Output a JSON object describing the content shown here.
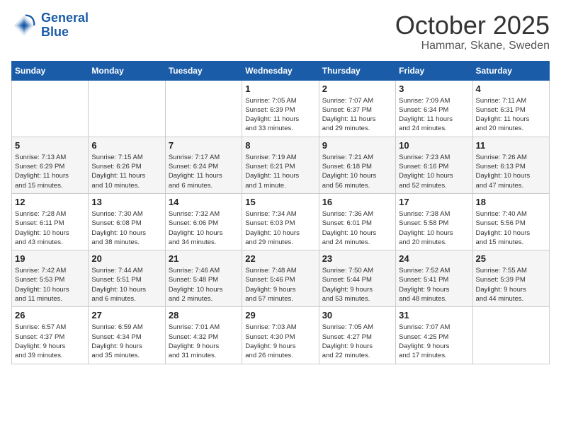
{
  "header": {
    "logo_line1": "General",
    "logo_line2": "Blue",
    "month": "October 2025",
    "location": "Hammar, Skane, Sweden"
  },
  "days_of_week": [
    "Sunday",
    "Monday",
    "Tuesday",
    "Wednesday",
    "Thursday",
    "Friday",
    "Saturday"
  ],
  "weeks": [
    [
      {
        "day": "",
        "info": ""
      },
      {
        "day": "",
        "info": ""
      },
      {
        "day": "",
        "info": ""
      },
      {
        "day": "1",
        "info": "Sunrise: 7:05 AM\nSunset: 6:39 PM\nDaylight: 11 hours\nand 33 minutes."
      },
      {
        "day": "2",
        "info": "Sunrise: 7:07 AM\nSunset: 6:37 PM\nDaylight: 11 hours\nand 29 minutes."
      },
      {
        "day": "3",
        "info": "Sunrise: 7:09 AM\nSunset: 6:34 PM\nDaylight: 11 hours\nand 24 minutes."
      },
      {
        "day": "4",
        "info": "Sunrise: 7:11 AM\nSunset: 6:31 PM\nDaylight: 11 hours\nand 20 minutes."
      }
    ],
    [
      {
        "day": "5",
        "info": "Sunrise: 7:13 AM\nSunset: 6:29 PM\nDaylight: 11 hours\nand 15 minutes."
      },
      {
        "day": "6",
        "info": "Sunrise: 7:15 AM\nSunset: 6:26 PM\nDaylight: 11 hours\nand 10 minutes."
      },
      {
        "day": "7",
        "info": "Sunrise: 7:17 AM\nSunset: 6:24 PM\nDaylight: 11 hours\nand 6 minutes."
      },
      {
        "day": "8",
        "info": "Sunrise: 7:19 AM\nSunset: 6:21 PM\nDaylight: 11 hours\nand 1 minute."
      },
      {
        "day": "9",
        "info": "Sunrise: 7:21 AM\nSunset: 6:18 PM\nDaylight: 10 hours\nand 56 minutes."
      },
      {
        "day": "10",
        "info": "Sunrise: 7:23 AM\nSunset: 6:16 PM\nDaylight: 10 hours\nand 52 minutes."
      },
      {
        "day": "11",
        "info": "Sunrise: 7:26 AM\nSunset: 6:13 PM\nDaylight: 10 hours\nand 47 minutes."
      }
    ],
    [
      {
        "day": "12",
        "info": "Sunrise: 7:28 AM\nSunset: 6:11 PM\nDaylight: 10 hours\nand 43 minutes."
      },
      {
        "day": "13",
        "info": "Sunrise: 7:30 AM\nSunset: 6:08 PM\nDaylight: 10 hours\nand 38 minutes."
      },
      {
        "day": "14",
        "info": "Sunrise: 7:32 AM\nSunset: 6:06 PM\nDaylight: 10 hours\nand 34 minutes."
      },
      {
        "day": "15",
        "info": "Sunrise: 7:34 AM\nSunset: 6:03 PM\nDaylight: 10 hours\nand 29 minutes."
      },
      {
        "day": "16",
        "info": "Sunrise: 7:36 AM\nSunset: 6:01 PM\nDaylight: 10 hours\nand 24 minutes."
      },
      {
        "day": "17",
        "info": "Sunrise: 7:38 AM\nSunset: 5:58 PM\nDaylight: 10 hours\nand 20 minutes."
      },
      {
        "day": "18",
        "info": "Sunrise: 7:40 AM\nSunset: 5:56 PM\nDaylight: 10 hours\nand 15 minutes."
      }
    ],
    [
      {
        "day": "19",
        "info": "Sunrise: 7:42 AM\nSunset: 5:53 PM\nDaylight: 10 hours\nand 11 minutes."
      },
      {
        "day": "20",
        "info": "Sunrise: 7:44 AM\nSunset: 5:51 PM\nDaylight: 10 hours\nand 6 minutes."
      },
      {
        "day": "21",
        "info": "Sunrise: 7:46 AM\nSunset: 5:48 PM\nDaylight: 10 hours\nand 2 minutes."
      },
      {
        "day": "22",
        "info": "Sunrise: 7:48 AM\nSunset: 5:46 PM\nDaylight: 9 hours\nand 57 minutes."
      },
      {
        "day": "23",
        "info": "Sunrise: 7:50 AM\nSunset: 5:44 PM\nDaylight: 9 hours\nand 53 minutes."
      },
      {
        "day": "24",
        "info": "Sunrise: 7:52 AM\nSunset: 5:41 PM\nDaylight: 9 hours\nand 48 minutes."
      },
      {
        "day": "25",
        "info": "Sunrise: 7:55 AM\nSunset: 5:39 PM\nDaylight: 9 hours\nand 44 minutes."
      }
    ],
    [
      {
        "day": "26",
        "info": "Sunrise: 6:57 AM\nSunset: 4:37 PM\nDaylight: 9 hours\nand 39 minutes."
      },
      {
        "day": "27",
        "info": "Sunrise: 6:59 AM\nSunset: 4:34 PM\nDaylight: 9 hours\nand 35 minutes."
      },
      {
        "day": "28",
        "info": "Sunrise: 7:01 AM\nSunset: 4:32 PM\nDaylight: 9 hours\nand 31 minutes."
      },
      {
        "day": "29",
        "info": "Sunrise: 7:03 AM\nSunset: 4:30 PM\nDaylight: 9 hours\nand 26 minutes."
      },
      {
        "day": "30",
        "info": "Sunrise: 7:05 AM\nSunset: 4:27 PM\nDaylight: 9 hours\nand 22 minutes."
      },
      {
        "day": "31",
        "info": "Sunrise: 7:07 AM\nSunset: 4:25 PM\nDaylight: 9 hours\nand 17 minutes."
      },
      {
        "day": "",
        "info": ""
      }
    ]
  ]
}
